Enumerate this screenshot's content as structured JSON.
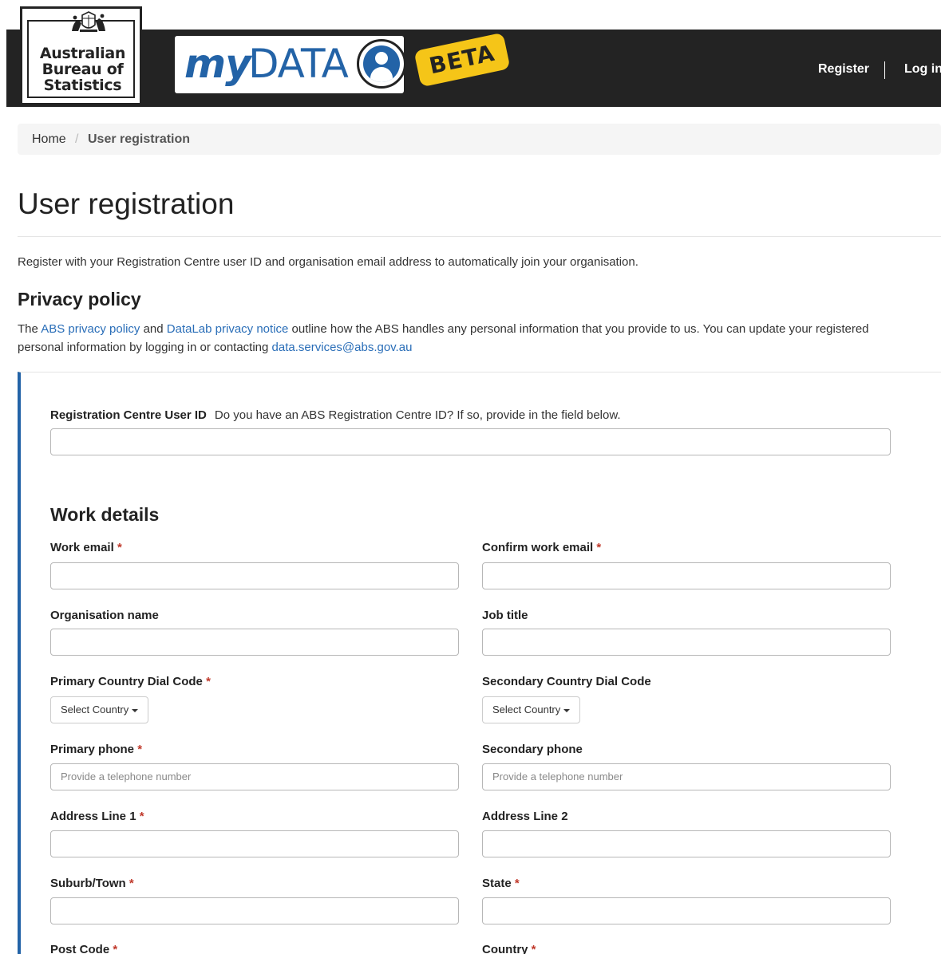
{
  "header": {
    "abs_logo": {
      "line1": "Australian",
      "line2": "Bureau of",
      "line3": "Statistics"
    },
    "mydata_logo": {
      "my": "my",
      "data": "DATA"
    },
    "beta_label": "BETA",
    "nav": {
      "register": "Register",
      "login": "Log in"
    }
  },
  "breadcrumb": {
    "home": "Home",
    "separator": "/",
    "current": "User registration"
  },
  "page": {
    "title": "User registration",
    "intro": "Register with your Registration Centre user ID and organisation email address to automatically join your organisation.",
    "privacy": {
      "heading": "Privacy policy",
      "text_1": "The ",
      "link_abs": "ABS privacy policy",
      "text_2": " and ",
      "link_datalab": "DataLab privacy notice",
      "text_3": " outline how the ABS handles any personal information that you provide to us. You can update your registered personal information by logging in or contacting ",
      "link_email": "data.services@abs.gov.au"
    }
  },
  "form": {
    "registration_id": {
      "label": "Registration Centre User ID",
      "hint": "Do you have an ABS Registration Centre ID? If so, provide in the field below.",
      "value": ""
    },
    "work_details_heading": "Work details",
    "required_marker": "*",
    "fields": {
      "work_email": {
        "label": "Work email",
        "required": true,
        "value": ""
      },
      "confirm_work_email": {
        "label": "Confirm work email",
        "required": true,
        "value": ""
      },
      "organisation_name": {
        "label": "Organisation name",
        "required": false,
        "value": ""
      },
      "job_title": {
        "label": "Job title",
        "required": false,
        "value": ""
      },
      "primary_dial_code": {
        "label": "Primary Country Dial Code",
        "required": true,
        "selected": "Select Country"
      },
      "secondary_dial_code": {
        "label": "Secondary Country Dial Code",
        "required": false,
        "selected": "Select Country"
      },
      "primary_phone": {
        "label": "Primary phone",
        "required": true,
        "placeholder": "Provide a telephone number"
      },
      "secondary_phone": {
        "label": "Secondary phone",
        "required": false,
        "placeholder": "Provide a telephone number"
      },
      "address_line_1": {
        "label": "Address Line 1",
        "required": true,
        "value": ""
      },
      "address_line_2": {
        "label": "Address Line 2",
        "required": false,
        "value": ""
      },
      "suburb_town": {
        "label": "Suburb/Town",
        "required": true,
        "value": ""
      },
      "state": {
        "label": "State",
        "required": true,
        "value": ""
      },
      "post_code": {
        "label": "Post Code",
        "required": true,
        "value": ""
      },
      "country": {
        "label": "Country",
        "required": true,
        "value": ""
      }
    }
  },
  "colors": {
    "header_bg": "#232323",
    "brand_blue": "#2363a7",
    "beta_yellow": "#f5c518",
    "link": "#2a6eb8",
    "required": "#c0392b"
  }
}
